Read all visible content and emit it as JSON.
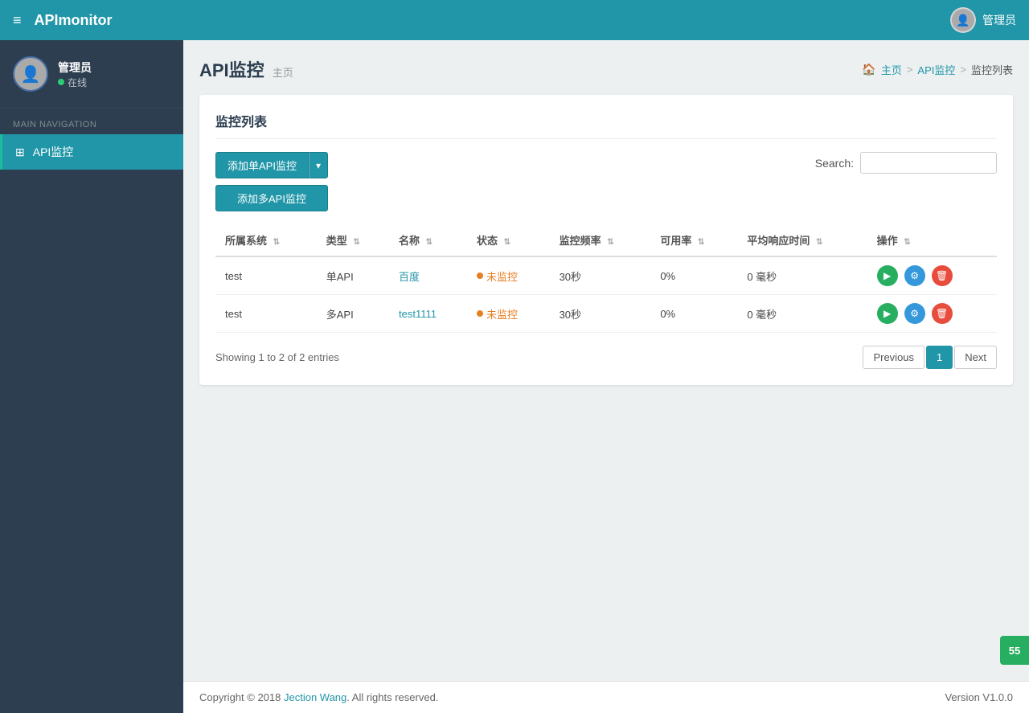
{
  "app": {
    "brand": "APImonitor",
    "brand_prefix": "API",
    "brand_suffix": "monitor"
  },
  "navbar": {
    "menu_icon": "≡",
    "user_label": "管理员"
  },
  "sidebar": {
    "username": "管理员",
    "status": "在线",
    "nav_label": "MAIN NAVIGATION",
    "nav_items": [
      {
        "id": "api-monitor",
        "label": "API监控",
        "icon": "⊞",
        "active": true
      }
    ]
  },
  "page": {
    "title": "API监控",
    "subtitle": "主页",
    "breadcrumb": {
      "home_label": "主页",
      "separator1": ">",
      "api_label": "API监控",
      "separator2": ">",
      "current": "监控列表"
    }
  },
  "card": {
    "title": "监控列表"
  },
  "toolbar": {
    "add_single_label": "添加单API监控",
    "dropdown_icon": "▾",
    "add_multi_label": "添加多API监控",
    "search_label": "Search:",
    "search_placeholder": ""
  },
  "table": {
    "columns": [
      {
        "id": "system",
        "label": "所属系统"
      },
      {
        "id": "type",
        "label": "类型"
      },
      {
        "id": "name",
        "label": "名称"
      },
      {
        "id": "status",
        "label": "状态"
      },
      {
        "id": "frequency",
        "label": "监控频率"
      },
      {
        "id": "availability",
        "label": "可用率"
      },
      {
        "id": "avg_response",
        "label": "平均响应时间"
      },
      {
        "id": "actions",
        "label": "操作"
      }
    ],
    "rows": [
      {
        "system": "test",
        "type": "单API",
        "name": "百度",
        "status": "未监控",
        "frequency": "30秒",
        "availability": "0%",
        "avg_response": "0 毫秒"
      },
      {
        "system": "test",
        "type": "多API",
        "name": "test1111",
        "status": "未监控",
        "frequency": "30秒",
        "availability": "0%",
        "avg_response": "0 毫秒"
      }
    ]
  },
  "pagination": {
    "entries_info": "Showing 1 to 2 of 2 entries",
    "previous_label": "Previous",
    "next_label": "Next",
    "current_page": "1"
  },
  "footer": {
    "copyright": "Copyright © 2018 ",
    "brand_name": "Jection Wang",
    "rights": ". All rights reserved.",
    "version": "Version V1.0.0"
  },
  "floating": {
    "timer_value": "55"
  }
}
